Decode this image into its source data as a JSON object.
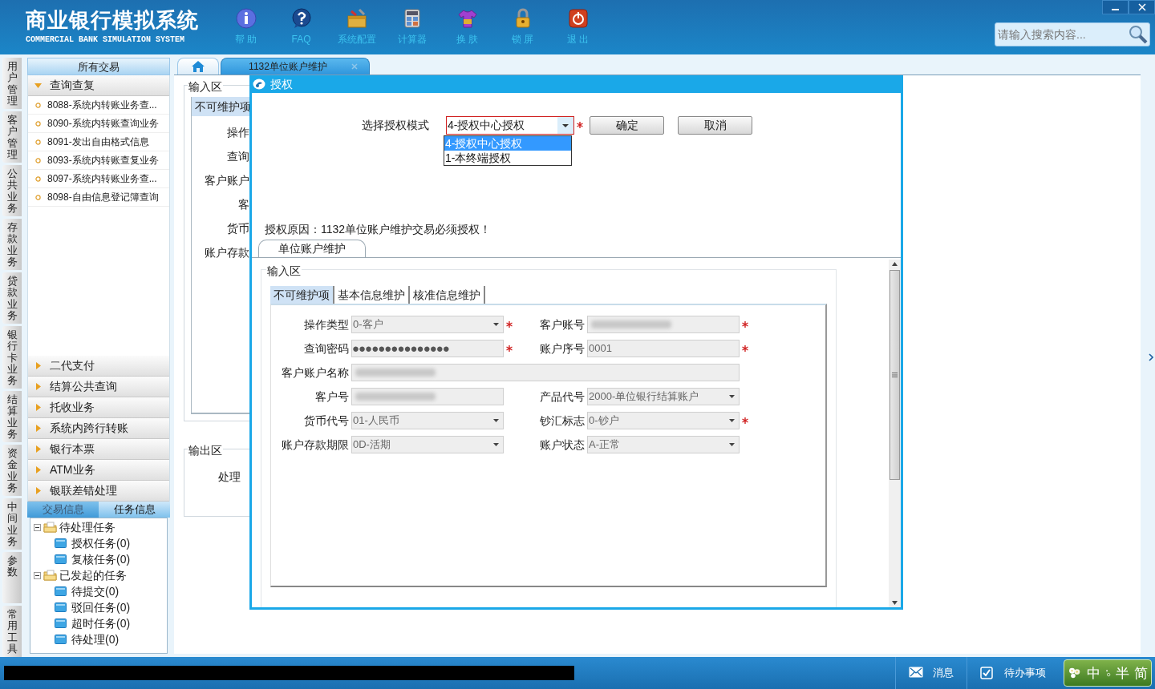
{
  "app": {
    "title": "商业银行模拟系统",
    "subtitle": "COMMERCIAL BANK SIMULATION SYSTEM"
  },
  "toolbar": [
    {
      "label": "帮 助",
      "kind": "info"
    },
    {
      "label": "FAQ",
      "kind": "faq"
    },
    {
      "label": "系统配置",
      "kind": "config"
    },
    {
      "label": "计算器",
      "kind": "calc"
    },
    {
      "label": "换 肤",
      "kind": "skin"
    },
    {
      "label": "锁 屏",
      "kind": "lock"
    },
    {
      "label": "退 出",
      "kind": "exit"
    }
  ],
  "search": {
    "placeholder": "请输入搜索内容..."
  },
  "side_tabs": [
    "用户管理",
    "客户管理",
    "公共业务",
    "存款业务",
    "贷款业务",
    "银行卡业务",
    "结算业务",
    "资金业务",
    "中间业务",
    "参数",
    "常用工具"
  ],
  "menu": {
    "title": "所有交易",
    "groups": [
      {
        "label": "查询查复",
        "expanded": true,
        "items": [
          "8088-系统内转账业务查...",
          "8090-系统内转账查询业务",
          "8091-发出自由格式信息",
          "8093-系统内转账查复业务",
          "8097-系统内转账业务查...",
          "8098-自由信息登记簿查询"
        ]
      },
      {
        "label": "二代支付",
        "expanded": false
      },
      {
        "label": "结算公共查询",
        "expanded": false
      },
      {
        "label": "托收业务",
        "expanded": false
      },
      {
        "label": "系统内跨行转账",
        "expanded": false
      },
      {
        "label": "银行本票",
        "expanded": false
      },
      {
        "label": "ATM业务",
        "expanded": false
      },
      {
        "label": "银联差错处理",
        "expanded": false
      }
    ]
  },
  "task_tabs": [
    {
      "label": "交易信息",
      "selected": false
    },
    {
      "label": "任务信息",
      "selected": true
    }
  ],
  "task_tree": [
    {
      "label": "待处理任务",
      "expanded": true,
      "children": [
        {
          "label": "授权任务(0)"
        },
        {
          "label": "复核任务(0)"
        }
      ]
    },
    {
      "label": "已发起的任务",
      "expanded": true,
      "children": [
        {
          "label": "待提交(0)"
        },
        {
          "label": "驳回任务(0)"
        },
        {
          "label": "超时任务(0)"
        },
        {
          "label": "待处理(0)"
        }
      ]
    }
  ],
  "page_tabs": [
    {
      "kind": "home",
      "selected": false
    },
    {
      "kind": "page",
      "label": "1132单位账户维护",
      "selected": true
    }
  ],
  "background_form": {
    "input_legend": "输入区",
    "tab": "不可维护项",
    "labels": [
      "操作",
      "查询",
      "客户账户",
      "客",
      "货币",
      "账户存款"
    ],
    "output_legend": "输出区",
    "output_label": "处理"
  },
  "dialog": {
    "title": "授权",
    "mode_label": "选择授权模式",
    "mode_value": "4-授权中心授权",
    "mode_required": true,
    "options": [
      {
        "label": "4-授权中心授权",
        "selected": true
      },
      {
        "label": "1-本终端授权",
        "selected": false
      }
    ],
    "buttons": [
      "确定",
      "取消"
    ],
    "reason": "授权原因：1132单位账户维护交易必须授权！",
    "tab": "单位账户维护",
    "legend": "输入区",
    "tabs": [
      {
        "label": "不可维护项",
        "selected": true
      },
      {
        "label": "基本信息维护",
        "selected": false
      },
      {
        "label": "核准信息维护",
        "selected": false
      }
    ],
    "fields": [
      {
        "label": "操作类型",
        "kind": "select",
        "value": "0-客户",
        "required": true
      },
      {
        "label": "客户账号",
        "kind": "blurred",
        "required": true
      },
      {
        "label": "查询密码",
        "kind": "password",
        "value": "●●●●●●●●●●●●●●●",
        "required": true
      },
      {
        "label": "账户序号",
        "kind": "text",
        "value": "0001",
        "required": true
      },
      {
        "label": "客户账户名称",
        "kind": "blurred",
        "wide": true,
        "required": false
      },
      {
        "label": "客户号",
        "kind": "blurred",
        "required": false
      },
      {
        "label": "产品代号",
        "kind": "select",
        "value": "2000-单位银行结算账户",
        "required": false
      },
      {
        "label": "货币代号",
        "kind": "select",
        "value": "01-人民币",
        "required": false
      },
      {
        "label": "钞汇标志",
        "kind": "select",
        "value": "0-钞户",
        "required": true
      },
      {
        "label": "账户存款期限",
        "kind": "select",
        "value": "0D-活期",
        "required": false
      },
      {
        "label": "账户状态",
        "kind": "select",
        "value": "A-正常",
        "required": false
      }
    ]
  },
  "status_bar": {
    "items": [
      {
        "label": "消息",
        "kind": "message"
      },
      {
        "label": "待办事项",
        "kind": "todo"
      }
    ],
    "ime": [
      "中",
      "半",
      "简"
    ]
  }
}
